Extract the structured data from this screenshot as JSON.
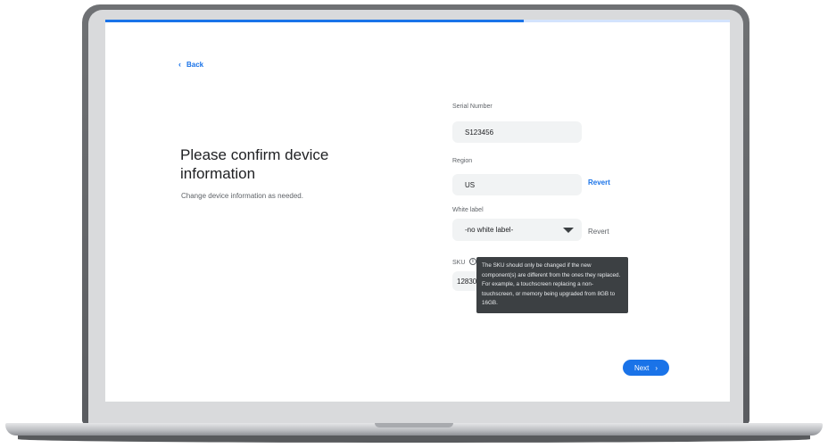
{
  "setup": {
    "progress_fraction": 0.67,
    "back_label": "Back",
    "title": "Please confirm device information",
    "subtitle": "Change device information as needed.",
    "next_label": "Next"
  },
  "fields": {
    "serial_number": {
      "label": "Serial Number",
      "value": "S123456"
    },
    "region": {
      "label": "Region",
      "value": "US",
      "revert_label": "Revert"
    },
    "white_label": {
      "label": "White label",
      "value": "-no white label-",
      "revert_label": "Revert"
    },
    "sku": {
      "label": "SKU",
      "value": "12830-",
      "info_glyph": "i"
    }
  },
  "tooltip": {
    "text": "The SKU should only be changed if the new component(s) are different from the ones they replaced. For example, a touchscreen replacing a non-touchscreen, or memory being upgraded from 8GB to 16GB."
  },
  "icons": {
    "back": "chevron-left-icon",
    "dropdown": "triangle-down-icon",
    "info": "info-icon",
    "next": "chevron-right-icon"
  },
  "colors": {
    "accent": "#1a73e8",
    "tooltip_bg": "#3c4043",
    "field_bg": "#f1f3f4"
  }
}
